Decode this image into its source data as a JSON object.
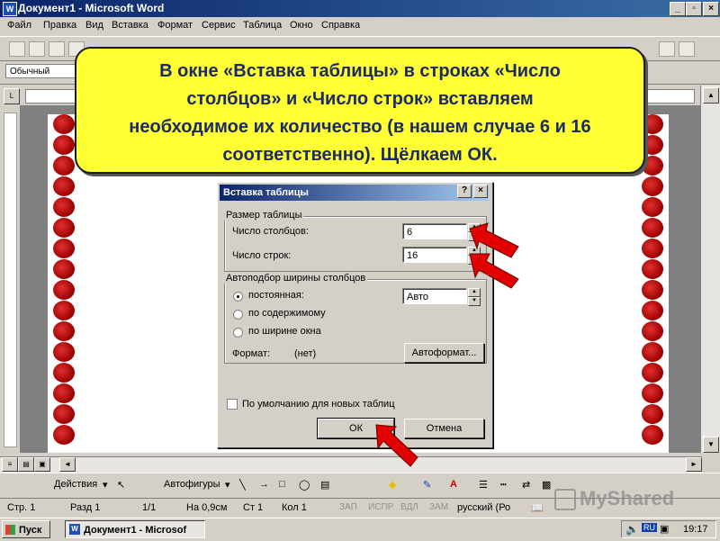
{
  "window": {
    "title": "Документ1 - Microsoft Word",
    "min": "_",
    "max": "▫",
    "close": "×"
  },
  "menu": [
    "Файл",
    "Правка",
    "Вид",
    "Вставка",
    "Формат",
    "Сервис",
    "Таблица",
    "Окно",
    "Справка"
  ],
  "formatting": {
    "style": "Обычный"
  },
  "callout": {
    "lines": [
      "В окне «Вставка таблицы» в строках «Число",
      "столбцов» и «Число строк» вставляем",
      "необходимое их количество (в нашем случае 6 и 16",
      "соответственно). Щёлкаем ОК."
    ]
  },
  "dialog": {
    "title": "Вставка таблицы",
    "help": "?",
    "close": "×",
    "size_group": "Размер таблицы",
    "columns_label": "Число столбцов:",
    "columns_value": "6",
    "rows_label": "Число строк:",
    "rows_value": "16",
    "autofit_group": "Автоподбор ширины столбцов",
    "fixed_label": "постоянная:",
    "fixed_value": "Авто",
    "by_content_label": "по содержимому",
    "by_window_label": "по ширине окна",
    "format_label": "Формат:",
    "format_value": "(нет)",
    "autoformat_button": "Автоформат...",
    "default_checkbox": "По умолчанию для новых таблиц",
    "ok_button": "ОК",
    "cancel_button": "Отмена"
  },
  "drawing": {
    "actions": "Действия",
    "autoshapes": "Автофигуры"
  },
  "status": {
    "page": "Стр. 1",
    "section": "Разд 1",
    "pages": "1/1",
    "at": "На 0,9см",
    "line": "Ст 1",
    "col": "Кол 1",
    "rec": "ЗАП",
    "trk": "ИСПР",
    "ext": "ВДЛ",
    "ovr": "ЗАМ",
    "lang": "русский (Ро"
  },
  "taskbar": {
    "start": "Пуск",
    "task": "Документ1 - Microsof",
    "lang": "RU",
    "time": "19:17"
  },
  "watermark": "MyShared",
  "colors": {
    "titlebar": "#0a246a",
    "callout_bg": "#ffff33",
    "callout_text": "#1c2a66",
    "arrow": "#e00000"
  }
}
